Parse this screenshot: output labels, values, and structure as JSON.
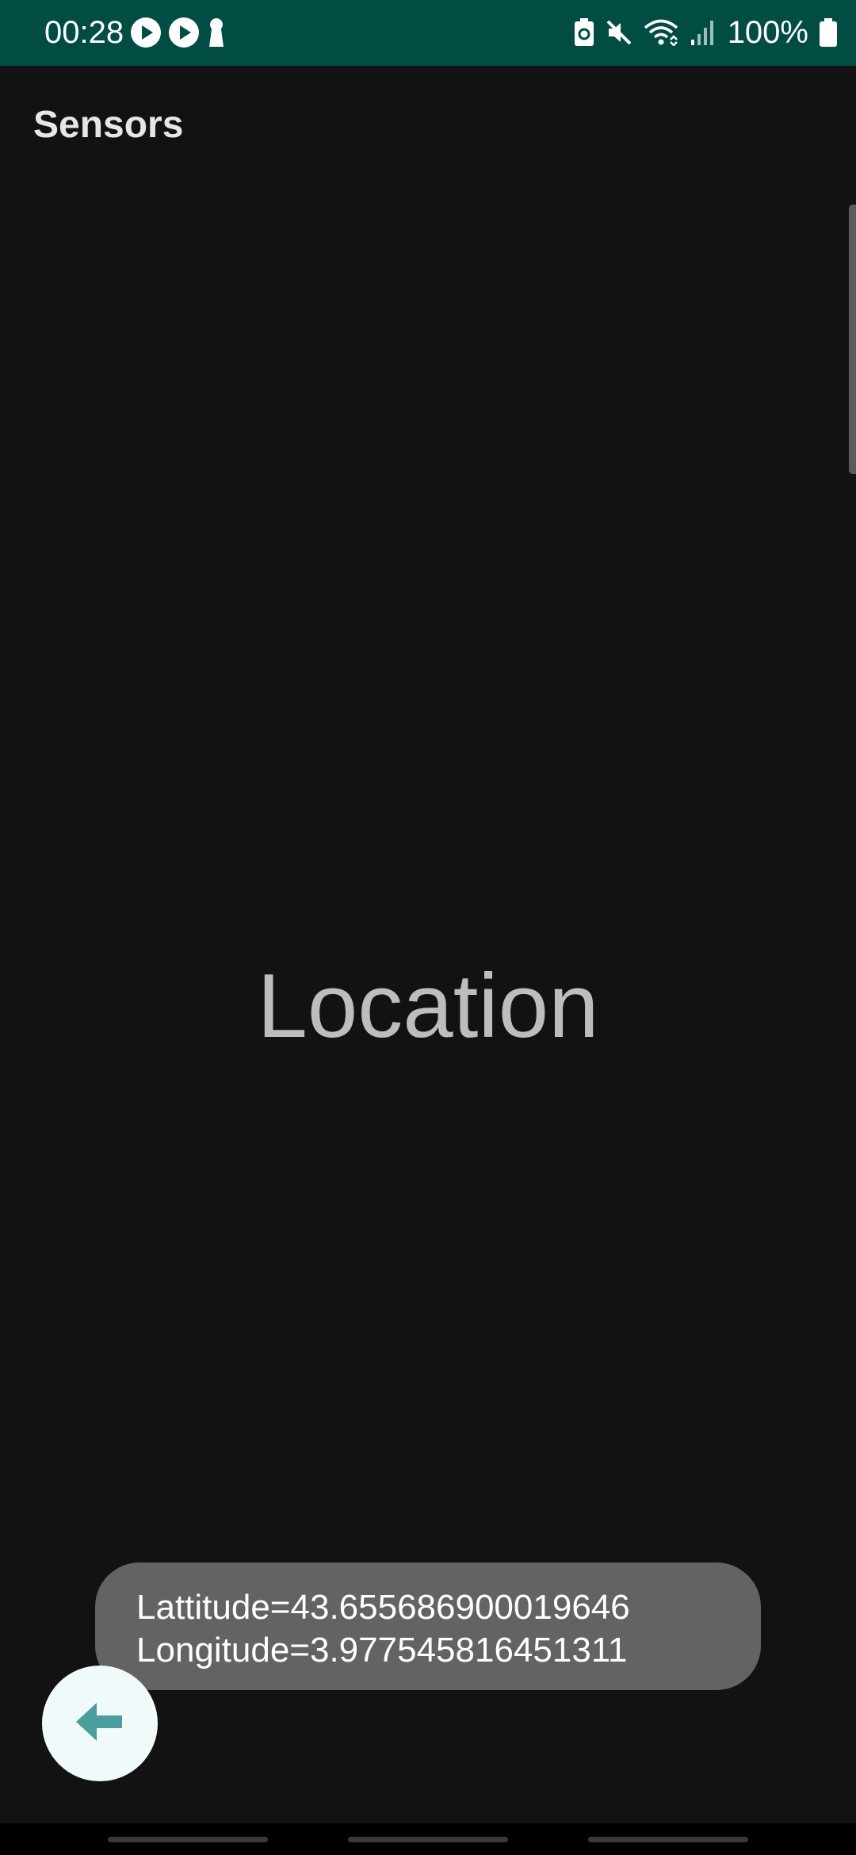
{
  "status_bar": {
    "time": "00:28",
    "battery_percent": "100%",
    "background_color": "#014d44",
    "left_icons": [
      "play-circle-icon",
      "play-circle-icon",
      "keyhole-icon"
    ],
    "right_icons": [
      "battery-saver-icon",
      "mute-icon",
      "wifi-icon",
      "signal-icon",
      "battery-icon"
    ]
  },
  "app_bar": {
    "title": "Sensors"
  },
  "main": {
    "label": "Location"
  },
  "toast": {
    "latitude_line": "Lattitude=43.655686900019646",
    "longitude_line": "Longitude=3.977545816451311"
  },
  "fab": {
    "icon": "arrow-left-icon",
    "accent_color": "#4a9e9e"
  }
}
